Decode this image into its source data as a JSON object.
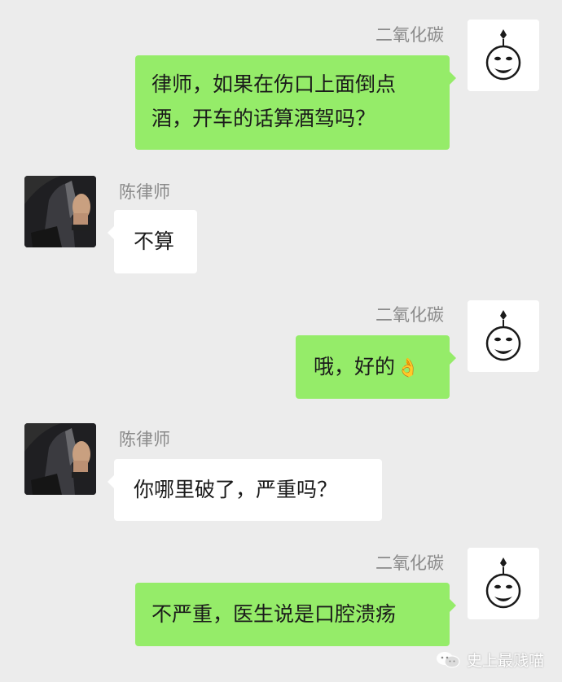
{
  "messages": [
    {
      "sender": "二氧化碳",
      "direction": "out",
      "lines": [
        "律师，如果在伤口上面倒点",
        "酒，开车的话算酒驾吗？"
      ]
    },
    {
      "sender": "陈律师",
      "direction": "in",
      "lines": [
        "不算"
      ]
    },
    {
      "sender": "二氧化碳",
      "direction": "out",
      "text": "哦，好的",
      "emoji": "👌"
    },
    {
      "sender": "陈律师",
      "direction": "in",
      "lines": [
        "你哪里破了，严重吗？"
      ]
    },
    {
      "sender": "二氧化碳",
      "direction": "out",
      "lines": [
        "不严重，医生说是口腔溃疡"
      ]
    }
  ],
  "watermark": {
    "icon": "wechat-icon",
    "text": "史上最贱喵"
  },
  "colors": {
    "background": "#ececec",
    "outgoing_bubble": "#95ec69",
    "incoming_bubble": "#ffffff",
    "sender_name": "#8a8a8a"
  }
}
